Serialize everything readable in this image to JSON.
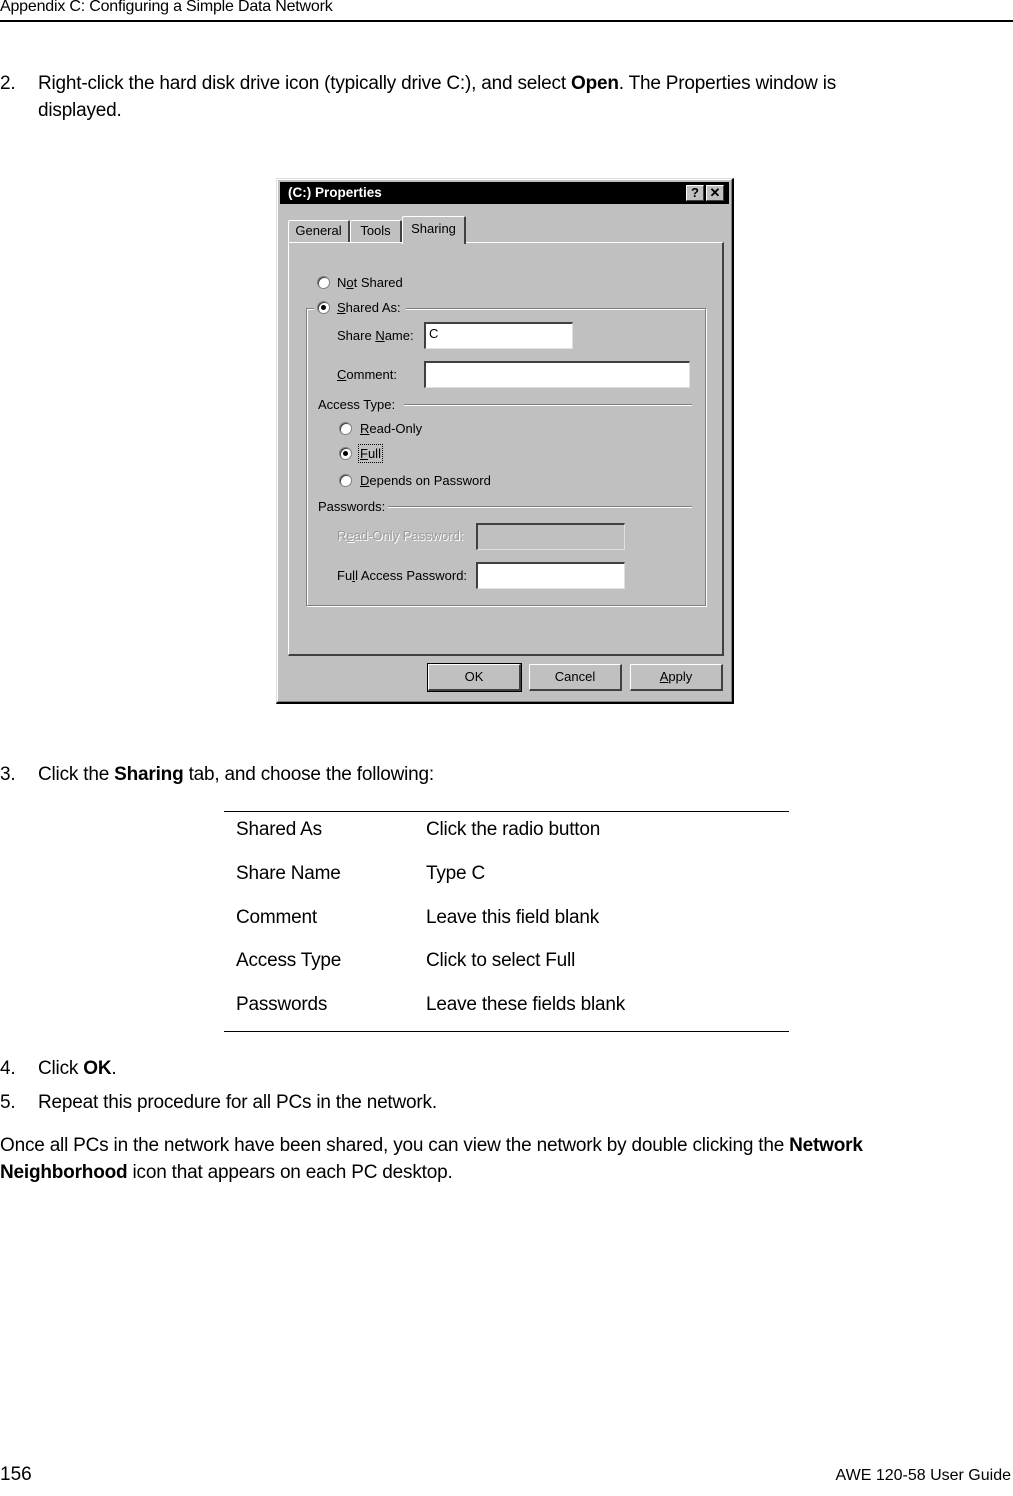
{
  "header": {
    "title": "Appendix C: Configuring a Simple Data Network"
  },
  "steps": {
    "step2": {
      "num": "2.",
      "line1_pre": "Right-click the hard disk drive icon (typically drive C:), and select ",
      "line1_bold": "Open",
      "line1_post": ". The Properties window is",
      "line2": "displayed."
    },
    "step3": {
      "num": "3.",
      "pre": "Click the ",
      "bold": "Sharing",
      "post": " tab, and choose the following:"
    },
    "step4": {
      "num": "4.",
      "pre": "Click ",
      "bold": "OK",
      "post": "."
    },
    "step5": {
      "num": "5.",
      "text": "Repeat this procedure for all PCs in the network."
    }
  },
  "closing": {
    "line1_pre": "Once all PCs in the network have been shared, you can view the network by double clicking the ",
    "line1_bold": "Network",
    "line2_bold": "Neighborhood",
    "line2_post": " icon that appears on each PC desktop."
  },
  "dialog": {
    "title": "(C:) Properties",
    "help_label": "?",
    "close_label": "✕",
    "tabs": [
      {
        "label": "General",
        "active": false
      },
      {
        "label": "Tools",
        "active": false
      },
      {
        "label": "Sharing",
        "active": true
      }
    ],
    "not_shared": {
      "pre": "N",
      "ul": "o",
      "post": "t Shared",
      "checked": false
    },
    "shared_as": {
      "ul": "S",
      "post": "hared As:",
      "checked": true
    },
    "share_name": {
      "pre": "Share ",
      "ul": "N",
      "post": "ame:",
      "value": "C"
    },
    "comment": {
      "ul": "C",
      "post": "omment:",
      "value": ""
    },
    "access_type_label": "Access Type:",
    "access": [
      {
        "ul": "R",
        "post": "ead-Only",
        "checked": false
      },
      {
        "ul": "F",
        "post": "ull",
        "checked": true
      },
      {
        "ul": "D",
        "post": "epends on Password",
        "checked": false
      }
    ],
    "passwords_label": "Passwords:",
    "read_only_password": {
      "pre": "R",
      "ul": "e",
      "post": "ad-Only Password:",
      "value": "",
      "disabled": true
    },
    "full_access_password": {
      "pre": "Fu",
      "ul": "l",
      "post": "l Access Password:",
      "value": ""
    },
    "buttons": {
      "ok": "OK",
      "cancel": "Cancel",
      "apply_ul": "A",
      "apply_post": "pply"
    }
  },
  "settings_table": {
    "rows": [
      {
        "field": "Shared As",
        "action": "Click the radio button"
      },
      {
        "field": "Share Name",
        "action": "Type C"
      },
      {
        "field": "Comment",
        "action": "Leave this field blank"
      },
      {
        "field": "Access Type",
        "action": "Click to select Full"
      },
      {
        "field": "Passwords",
        "action": "Leave these fields blank"
      }
    ]
  },
  "footer": {
    "page_number": "156",
    "guide_title": "AWE 120-58 User Guide"
  }
}
